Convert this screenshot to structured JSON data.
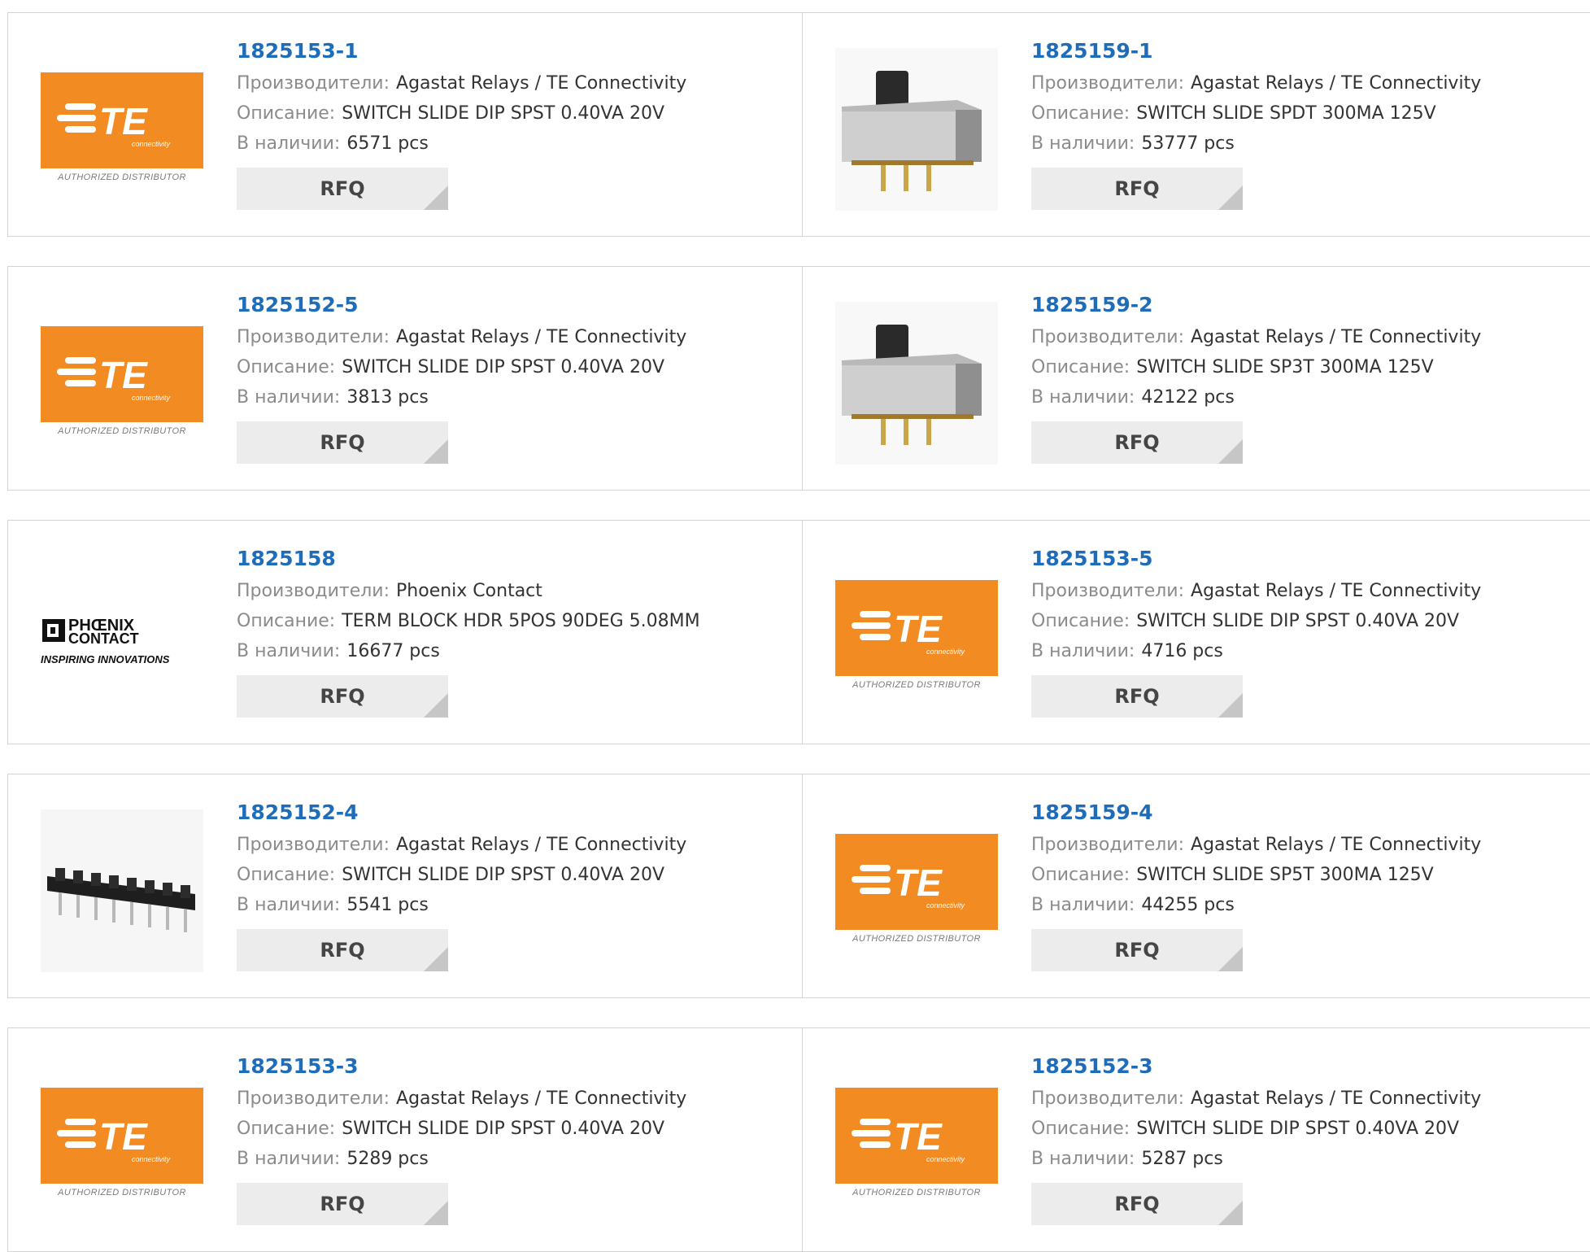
{
  "labels": {
    "manufacturer": "Производители:",
    "description": "Описание:",
    "stock": "В наличии:",
    "rfq": "RFQ",
    "authorized": "AUTHORIZED DISTRIBUTOR",
    "te_word": "TE",
    "te_sub": "connectivity",
    "phoenix_line1": "PHŒNIX",
    "phoenix_line2": "CONTACT",
    "phoenix_tagline": "INSPIRING INNOVATIONS"
  },
  "colors": {
    "link": "#1f6db8",
    "te_orange": "#f28b22",
    "border": "#d4d4d4",
    "button_bg": "#ececec"
  },
  "products": [
    {
      "part": "1825153-1",
      "manufacturer": "Agastat Relays / TE Connectivity",
      "description": "SWITCH SLIDE DIP SPST 0.40VA 20V",
      "stock": "6571 pcs",
      "image": "te-logo"
    },
    {
      "part": "1825159-1",
      "manufacturer": "Agastat Relays / TE Connectivity",
      "description": "SWITCH SLIDE SPDT 300MA 125V",
      "stock": "53777 pcs",
      "image": "slide-switch-photo"
    },
    {
      "part": "1825152-5",
      "manufacturer": "Agastat Relays / TE Connectivity",
      "description": "SWITCH SLIDE DIP SPST 0.40VA 20V",
      "stock": "3813 pcs",
      "image": "te-logo"
    },
    {
      "part": "1825159-2",
      "manufacturer": "Agastat Relays / TE Connectivity",
      "description": "SWITCH SLIDE SP3T 300MA 125V",
      "stock": "42122 pcs",
      "image": "slide-switch-photo"
    },
    {
      "part": "1825158",
      "manufacturer": "Phoenix Contact",
      "description": "TERM BLOCK HDR 5POS 90DEG 5.08MM",
      "stock": "16677 pcs",
      "image": "phoenix-logo"
    },
    {
      "part": "1825153-5",
      "manufacturer": "Agastat Relays / TE Connectivity",
      "description": "SWITCH SLIDE DIP SPST 0.40VA 20V",
      "stock": "4716 pcs",
      "image": "te-logo"
    },
    {
      "part": "1825152-4",
      "manufacturer": "Agastat Relays / TE Connectivity",
      "description": "SWITCH SLIDE DIP SPST 0.40VA 20V",
      "stock": "5541 pcs",
      "image": "dip-switch-photo"
    },
    {
      "part": "1825159-4",
      "manufacturer": "Agastat Relays / TE Connectivity",
      "description": "SWITCH SLIDE SP5T 300MA 125V",
      "stock": "44255 pcs",
      "image": "te-logo"
    },
    {
      "part": "1825153-3",
      "manufacturer": "Agastat Relays / TE Connectivity",
      "description": "SWITCH SLIDE DIP SPST 0.40VA 20V",
      "stock": "5289 pcs",
      "image": "te-logo"
    },
    {
      "part": "1825152-3",
      "manufacturer": "Agastat Relays / TE Connectivity",
      "description": "SWITCH SLIDE DIP SPST 0.40VA 20V",
      "stock": "5287 pcs",
      "image": "te-logo"
    }
  ]
}
